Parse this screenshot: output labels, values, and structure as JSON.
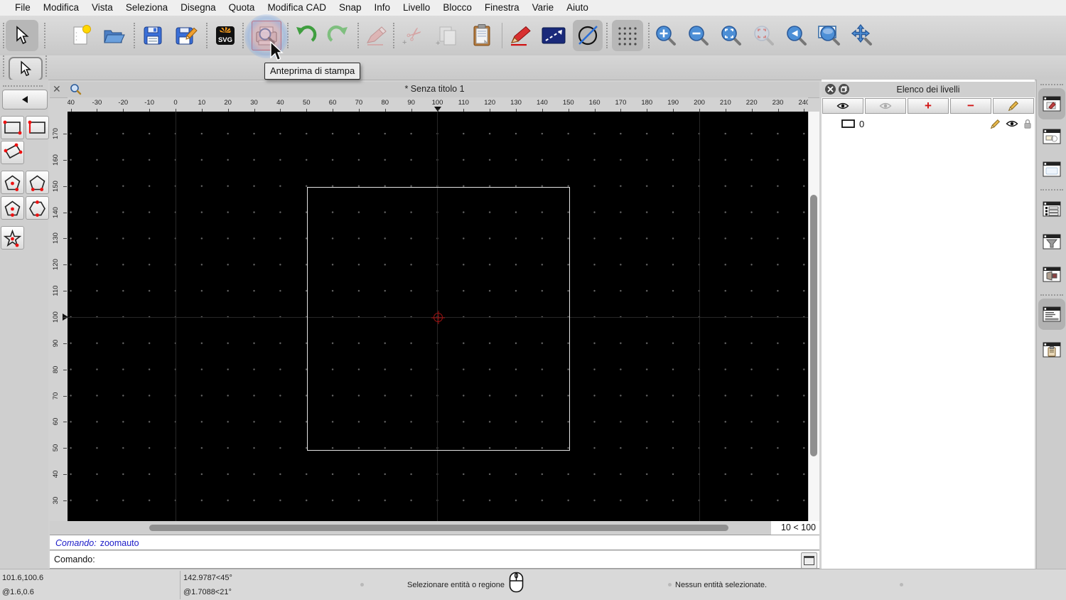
{
  "menu_bar": {
    "items": [
      "File",
      "Modifica",
      "Vista",
      "Seleziona",
      "Disegna",
      "Quota",
      "Modifica CAD",
      "Snap",
      "Info",
      "Livello",
      "Blocco",
      "Finestra",
      "Varie",
      "Aiuto"
    ]
  },
  "toolbar": {
    "tooltip": "Anteprima di stampa",
    "svg_label": "SVG",
    "buttons": [
      "select",
      "new-document",
      "open-file",
      "save",
      "save-as",
      "export-svg",
      "print-preview",
      "undo",
      "redo",
      "erase",
      "cut",
      "copy",
      "paste",
      "pen",
      "line-attributes",
      "construction-circle",
      "grid-toggle",
      "zoom-in",
      "zoom-out",
      "zoom-auto",
      "zoom-redraw",
      "zoom-previous",
      "zoom-window",
      "zoom-pan"
    ]
  },
  "left_toolbar": {
    "buttons": [
      "back",
      "rectangle-2-corners",
      "rectangle-sides",
      "rectangle-rotated",
      "polygon-center-corner",
      "polygon-2-corners",
      "polygon-center-side",
      "polygon-side-side",
      "star"
    ]
  },
  "document": {
    "title": "* Senza titolo 1",
    "ruler_top_labels": [
      "40",
      "-30",
      "-20",
      "-10",
      "0",
      "10",
      "20",
      "30",
      "40",
      "50",
      "60",
      "70",
      "80",
      "90",
      "100",
      "110",
      "120",
      "130",
      "140",
      "150",
      "160",
      "170",
      "180",
      "190",
      "200",
      "210",
      "220",
      "230",
      "240"
    ],
    "ruler_left_labels": [
      "170",
      "160",
      "150",
      "140",
      "130",
      "120",
      "110",
      "100",
      "90",
      "80",
      "70",
      "60",
      "50",
      "40",
      "30"
    ],
    "grid_status": "10 < 100"
  },
  "command_area": {
    "history_label": "Comando:",
    "history_value": "zoomauto",
    "prompt_label": "Comando:"
  },
  "layers_panel": {
    "title": "Elenco dei livelli",
    "toolbar_buttons": [
      "show-all-layers",
      "hide-all-layers",
      "add-layer",
      "remove-layer",
      "edit-layer"
    ],
    "add_glyph": "+",
    "remove_glyph": "−",
    "layers": [
      {
        "name": "0"
      }
    ]
  },
  "dock_strip": {
    "buttons": [
      "layers-dock-toggle",
      "blocks-dock-toggle",
      "library-dock-toggle",
      "list-dock-toggle",
      "filter-dock-toggle",
      "media-dock-toggle",
      "command-dock-toggle",
      "clipboard-dock-toggle"
    ]
  },
  "status_bar": {
    "coord_absolute": "101.6,100.6",
    "coord_relative": "@1.6,0.6",
    "polar_absolute": "142.9787<45°",
    "polar_relative": "@1.7088<21°",
    "hint": "Selezionare entità o regione",
    "selection_status": "Nessun entità selezionate."
  }
}
